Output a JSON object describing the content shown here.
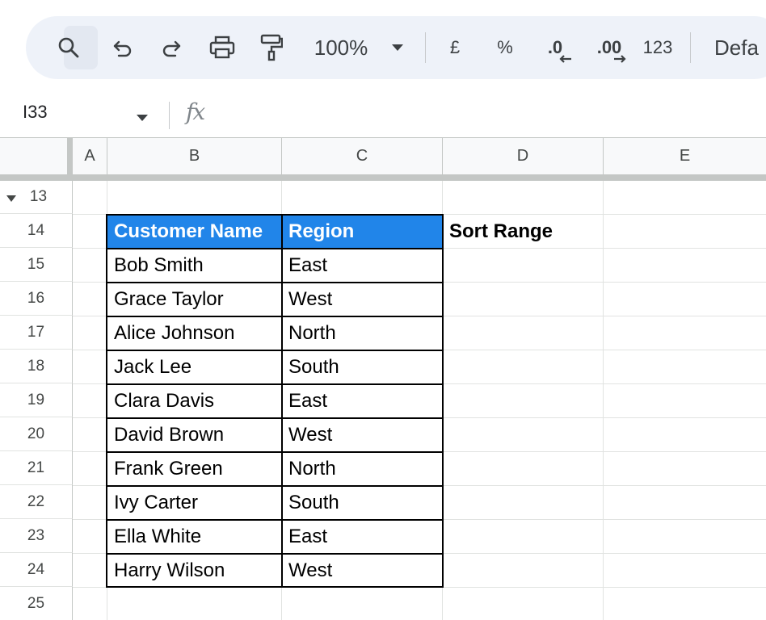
{
  "toolbar": {
    "zoom": "100%",
    "currency_label": "£",
    "percent_label": "%",
    "decrease_decimal_label": ".0",
    "increase_decimal_label": ".00",
    "number_format_label": "123",
    "font_label": "Defa"
  },
  "formula_bar": {
    "name_box": "I33",
    "fx_label": "fx",
    "formula": ""
  },
  "columns": [
    "A",
    "B",
    "C",
    "D",
    "E"
  ],
  "rows": [
    "13",
    "14",
    "15",
    "16",
    "17",
    "18",
    "19",
    "20",
    "21",
    "22",
    "23",
    "24",
    "25"
  ],
  "table": {
    "headers": [
      "Customer Name",
      "Region"
    ],
    "rows": [
      [
        "Bob Smith",
        "East"
      ],
      [
        "Grace Taylor",
        "West"
      ],
      [
        "Alice Johnson",
        "North"
      ],
      [
        "Jack Lee",
        "South"
      ],
      [
        "Clara Davis",
        "East"
      ],
      [
        "David Brown",
        "West"
      ],
      [
        "Frank Green",
        "North"
      ],
      [
        "Ivy Carter",
        "South"
      ],
      [
        "Ella White",
        "East"
      ],
      [
        "Harry Wilson",
        "West"
      ]
    ]
  },
  "side_label": "Sort Range",
  "colors": {
    "toolbar_bg": "#eef2f9",
    "header_fill": "#2185e9",
    "header_text": "#ffffff",
    "gridline": "#e1e3e1"
  }
}
